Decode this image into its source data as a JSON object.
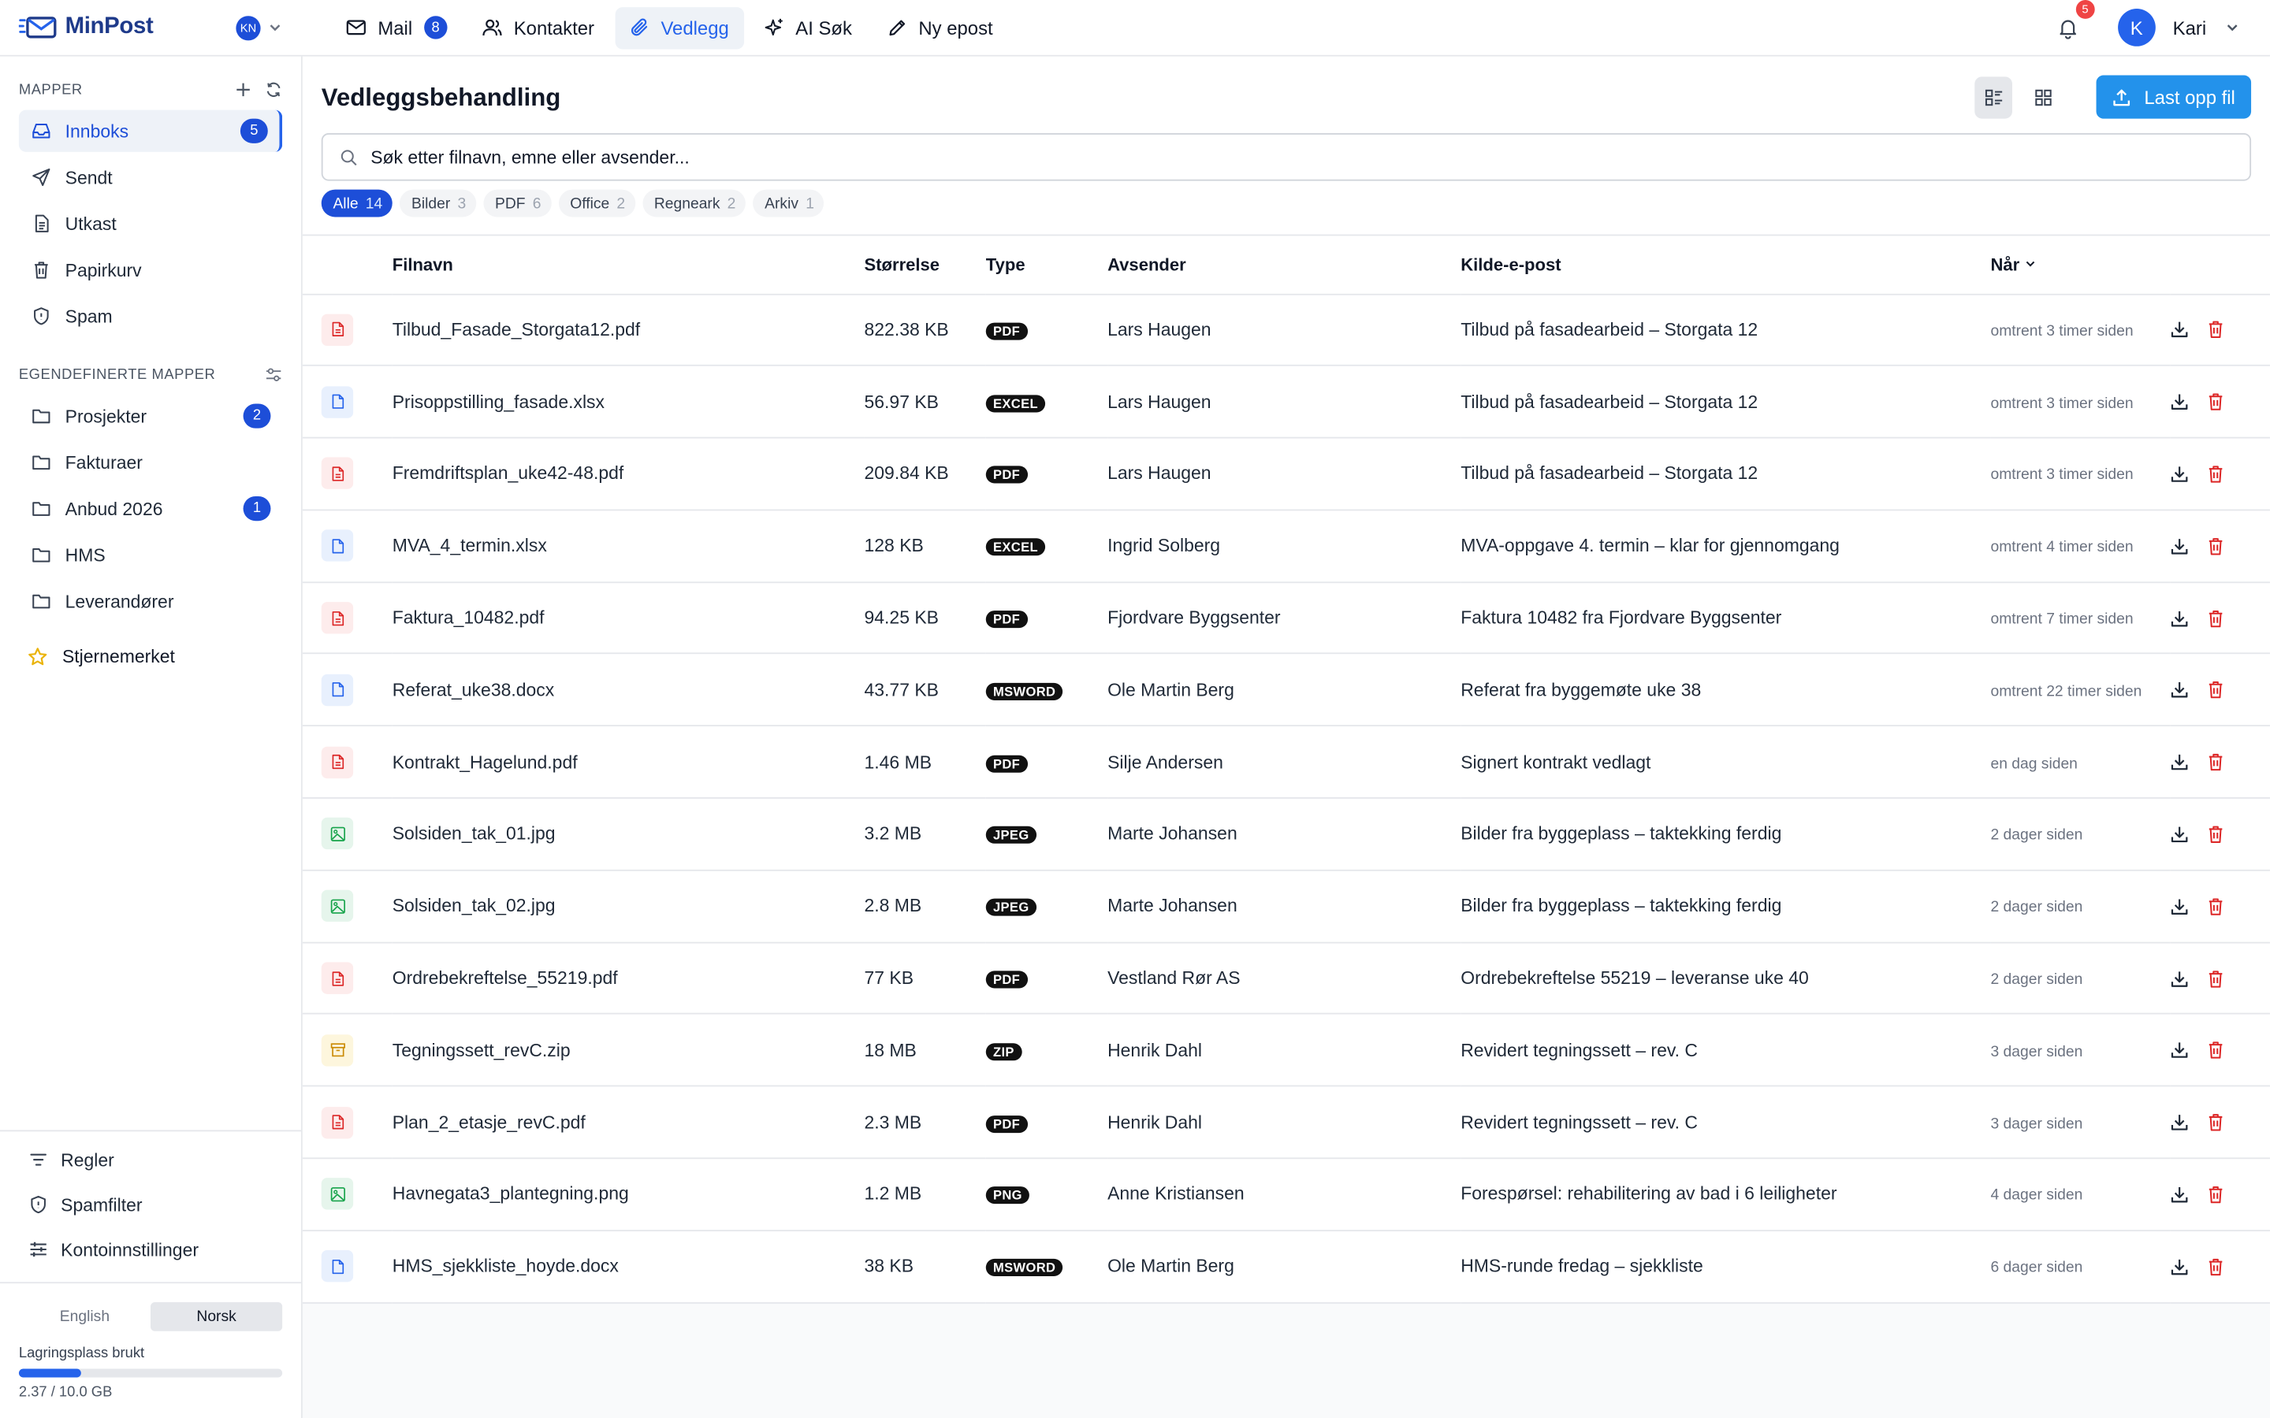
{
  "app": {
    "name": "MinPost",
    "account_initials": "KN",
    "brand_color": "#1e3a8a",
    "accent": "#2563eb"
  },
  "nav": {
    "items": [
      {
        "label": "Mail",
        "badge": "8",
        "icon": "mail-icon"
      },
      {
        "label": "Kontakter",
        "icon": "contacts-icon"
      },
      {
        "label": "Vedlegg",
        "icon": "paperclip-icon",
        "active": true
      },
      {
        "label": "AI Søk",
        "icon": "sparkles-icon"
      },
      {
        "label": "Ny epost",
        "icon": "pencil-icon"
      }
    ],
    "notifications": "5",
    "user_initial": "K",
    "user_name": "Kari"
  },
  "sidebar": {
    "folders_title": "MAPPER",
    "folders": [
      {
        "label": "Innboks",
        "count": "5",
        "icon": "inbox-icon",
        "active": true
      },
      {
        "label": "Sendt",
        "icon": "send-icon"
      },
      {
        "label": "Utkast",
        "icon": "draft-icon"
      },
      {
        "label": "Papirkurv",
        "icon": "trash-icon"
      },
      {
        "label": "Spam",
        "icon": "shield-icon"
      }
    ],
    "custom_title": "EGENDEFINERTE MAPPER",
    "custom_folders": [
      {
        "label": "Prosjekter",
        "count": "2"
      },
      {
        "label": "Fakturaer"
      },
      {
        "label": "Anbud 2026",
        "count": "1"
      },
      {
        "label": "HMS"
      },
      {
        "label": "Leverandører"
      }
    ],
    "starred": "Stjernemerket",
    "links": [
      "Regler",
      "Spamfilter",
      "Kontoinnstillinger"
    ],
    "languages": [
      "English",
      "Norsk"
    ],
    "active_language": "Norsk",
    "storage_label": "Lagringsplass brukt",
    "storage_value": "2.37 / 10.0 GB",
    "storage_fraction": 0.237
  },
  "main": {
    "title": "Vedleggsbehandling",
    "upload_label": "Last opp fil",
    "search_placeholder": "Søk etter filnavn, emne eller avsender...",
    "filters": [
      {
        "label": "Alle",
        "count": "14",
        "active": true
      },
      {
        "label": "Bilder",
        "count": "3"
      },
      {
        "label": "PDF",
        "count": "6"
      },
      {
        "label": "Office",
        "count": "2"
      },
      {
        "label": "Regneark",
        "count": "2"
      },
      {
        "label": "Arkiv",
        "count": "1"
      }
    ],
    "columns": {
      "name": "Filnavn",
      "size": "Størrelse",
      "type": "Type",
      "sender": "Avsender",
      "email": "Kilde-e-post",
      "when": "Når"
    },
    "rows": [
      {
        "kind": "pdf",
        "name": "Tilbud_Fasade_Storgata12.pdf",
        "size": "822.38 KB",
        "type": "PDF",
        "sender": "Lars Haugen",
        "email": "Tilbud på fasadearbeid – Storgata 12",
        "when": "omtrent 3 timer siden"
      },
      {
        "kind": "doc",
        "name": "Prisoppstilling_fasade.xlsx",
        "size": "56.97 KB",
        "type": "EXCEL",
        "sender": "Lars Haugen",
        "email": "Tilbud på fasadearbeid – Storgata 12",
        "when": "omtrent 3 timer siden"
      },
      {
        "kind": "pdf",
        "name": "Fremdriftsplan_uke42-48.pdf",
        "size": "209.84 KB",
        "type": "PDF",
        "sender": "Lars Haugen",
        "email": "Tilbud på fasadearbeid – Storgata 12",
        "when": "omtrent 3 timer siden"
      },
      {
        "kind": "doc",
        "name": "MVA_4_termin.xlsx",
        "size": "128 KB",
        "type": "EXCEL",
        "sender": "Ingrid Solberg",
        "email": "MVA-oppgave 4. termin – klar for gjennomgang",
        "when": "omtrent 4 timer siden"
      },
      {
        "kind": "pdf",
        "name": "Faktura_10482.pdf",
        "size": "94.25 KB",
        "type": "PDF",
        "sender": "Fjordvare Byggsenter",
        "email": "Faktura 10482 fra Fjordvare Byggsenter",
        "when": "omtrent 7 timer siden"
      },
      {
        "kind": "doc",
        "name": "Referat_uke38.docx",
        "size": "43.77 KB",
        "type": "MSWORD",
        "sender": "Ole Martin Berg",
        "email": "Referat fra byggemøte uke 38",
        "when": "omtrent 22 timer siden"
      },
      {
        "kind": "pdf",
        "name": "Kontrakt_Hagelund.pdf",
        "size": "1.46 MB",
        "type": "PDF",
        "sender": "Silje Andersen",
        "email": "Signert kontrakt vedlagt",
        "when": "en dag siden"
      },
      {
        "kind": "img",
        "name": "Solsiden_tak_01.jpg",
        "size": "3.2 MB",
        "type": "JPEG",
        "sender": "Marte Johansen",
        "email": "Bilder fra byggeplass – taktekking ferdig",
        "when": "2 dager siden"
      },
      {
        "kind": "img",
        "name": "Solsiden_tak_02.jpg",
        "size": "2.8 MB",
        "type": "JPEG",
        "sender": "Marte Johansen",
        "email": "Bilder fra byggeplass – taktekking ferdig",
        "when": "2 dager siden"
      },
      {
        "kind": "pdf",
        "name": "Ordrebekreftelse_55219.pdf",
        "size": "77 KB",
        "type": "PDF",
        "sender": "Vestland Rør AS",
        "email": "Ordrebekreftelse 55219 – leveranse uke 40",
        "when": "2 dager siden"
      },
      {
        "kind": "zip",
        "name": "Tegningssett_revC.zip",
        "size": "18 MB",
        "type": "ZIP",
        "sender": "Henrik Dahl",
        "email": "Revidert tegningssett – rev. C",
        "when": "3 dager siden"
      },
      {
        "kind": "pdf",
        "name": "Plan_2_etasje_revC.pdf",
        "size": "2.3 MB",
        "type": "PDF",
        "sender": "Henrik Dahl",
        "email": "Revidert tegningssett – rev. C",
        "when": "3 dager siden"
      },
      {
        "kind": "img",
        "name": "Havnegata3_plantegning.png",
        "size": "1.2 MB",
        "type": "PNG",
        "sender": "Anne Kristiansen",
        "email": "Forespørsel: rehabilitering av bad i 6 leiligheter",
        "when": "4 dager siden"
      },
      {
        "kind": "doc",
        "name": "HMS_sjekkliste_hoyde.docx",
        "size": "38 KB",
        "type": "MSWORD",
        "sender": "Ole Martin Berg",
        "email": "HMS-runde fredag – sjekkliste",
        "when": "6 dager siden"
      }
    ]
  }
}
